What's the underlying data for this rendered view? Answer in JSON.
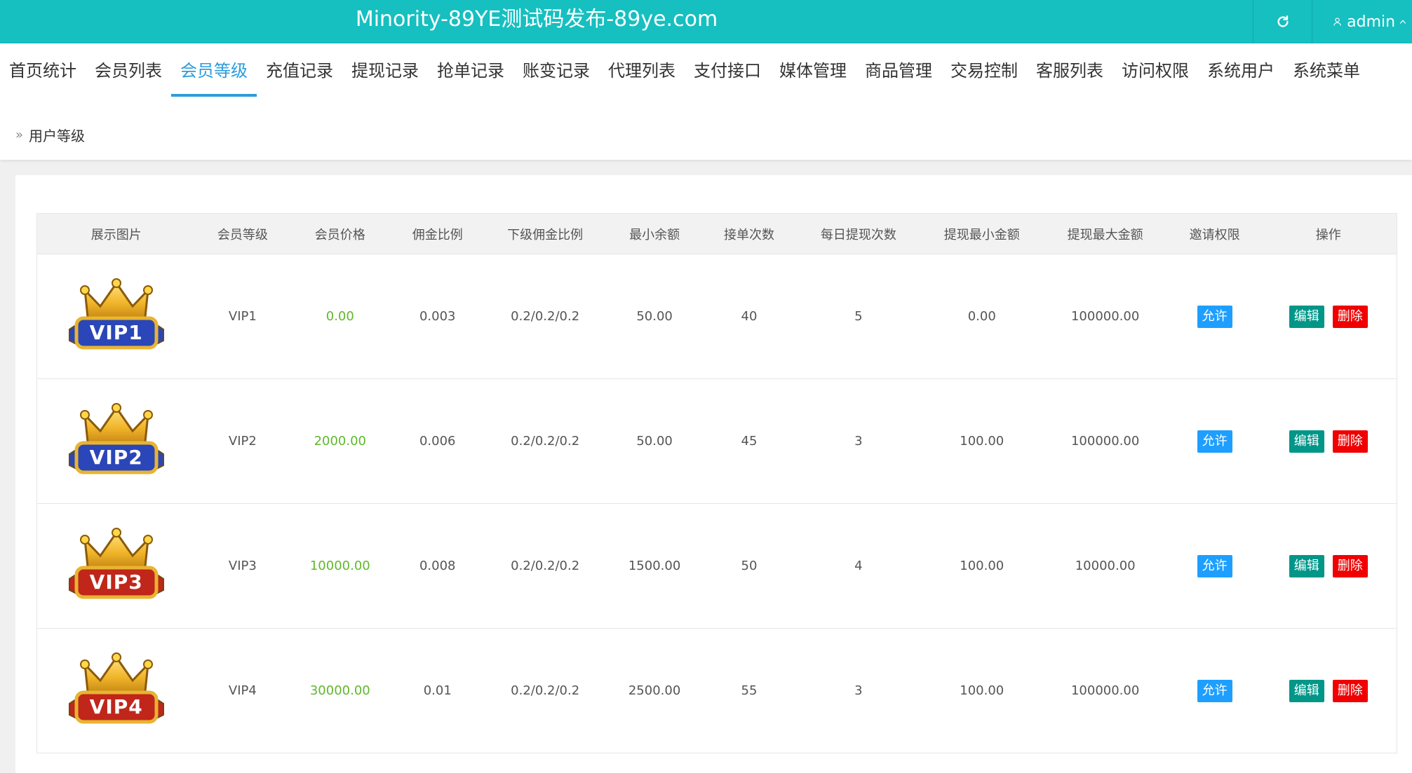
{
  "header": {
    "title": "Minority-89YE测试码发布-89ye.com",
    "refresh_icon": "refresh-icon",
    "user_icon": "user-icon",
    "username": "admin"
  },
  "nav": {
    "items": [
      {
        "label": "首页统计"
      },
      {
        "label": "会员列表"
      },
      {
        "label": "会员等级",
        "active": true
      },
      {
        "label": "充值记录"
      },
      {
        "label": "提现记录"
      },
      {
        "label": "抢单记录"
      },
      {
        "label": "账变记录"
      },
      {
        "label": "代理列表"
      },
      {
        "label": "支付接口"
      },
      {
        "label": "媒体管理"
      },
      {
        "label": "商品管理"
      },
      {
        "label": "交易控制"
      },
      {
        "label": "客服列表"
      },
      {
        "label": "访问权限"
      },
      {
        "label": "系统用户"
      },
      {
        "label": "系统菜单"
      }
    ]
  },
  "breadcrumb": {
    "label": "用户等级"
  },
  "table": {
    "headers": [
      "展示图片",
      "会员等级",
      "会员价格",
      "佣金比例",
      "下级佣金比例",
      "最小余额",
      "接单次数",
      "每日提现次数",
      "提现最小金额",
      "提现最大金额",
      "邀请权限",
      "操作"
    ],
    "rows": [
      {
        "badge": "VIP1",
        "badge_color": "#2a46b8",
        "level": "VIP1",
        "price": "0.00",
        "commission": "0.003",
        "sub_commission": "0.2/0.2/0.2",
        "min_balance": "50.00",
        "orders": "40",
        "daily_withdraw": "5",
        "withdraw_min": "0.00",
        "withdraw_max": "100000.00",
        "invite": "允许",
        "edit": "编辑",
        "delete": "删除"
      },
      {
        "badge": "VIP2",
        "badge_color": "#2a46b8",
        "level": "VIP2",
        "price": "2000.00",
        "commission": "0.006",
        "sub_commission": "0.2/0.2/0.2",
        "min_balance": "50.00",
        "orders": "45",
        "daily_withdraw": "3",
        "withdraw_min": "100.00",
        "withdraw_max": "100000.00",
        "invite": "允许",
        "edit": "编辑",
        "delete": "删除"
      },
      {
        "badge": "VIP3",
        "badge_color": "#c0261a",
        "level": "VIP3",
        "price": "10000.00",
        "commission": "0.008",
        "sub_commission": "0.2/0.2/0.2",
        "min_balance": "1500.00",
        "orders": "50",
        "daily_withdraw": "4",
        "withdraw_min": "100.00",
        "withdraw_max": "10000.00",
        "invite": "允许",
        "edit": "编辑",
        "delete": "删除"
      },
      {
        "badge": "VIP4",
        "badge_color": "#c0261a",
        "level": "VIP4",
        "price": "30000.00",
        "commission": "0.01",
        "sub_commission": "0.2/0.2/0.2",
        "min_balance": "2500.00",
        "orders": "55",
        "daily_withdraw": "3",
        "withdraw_min": "100.00",
        "withdraw_max": "100000.00",
        "invite": "允许",
        "edit": "编辑",
        "delete": "删除"
      }
    ]
  }
}
